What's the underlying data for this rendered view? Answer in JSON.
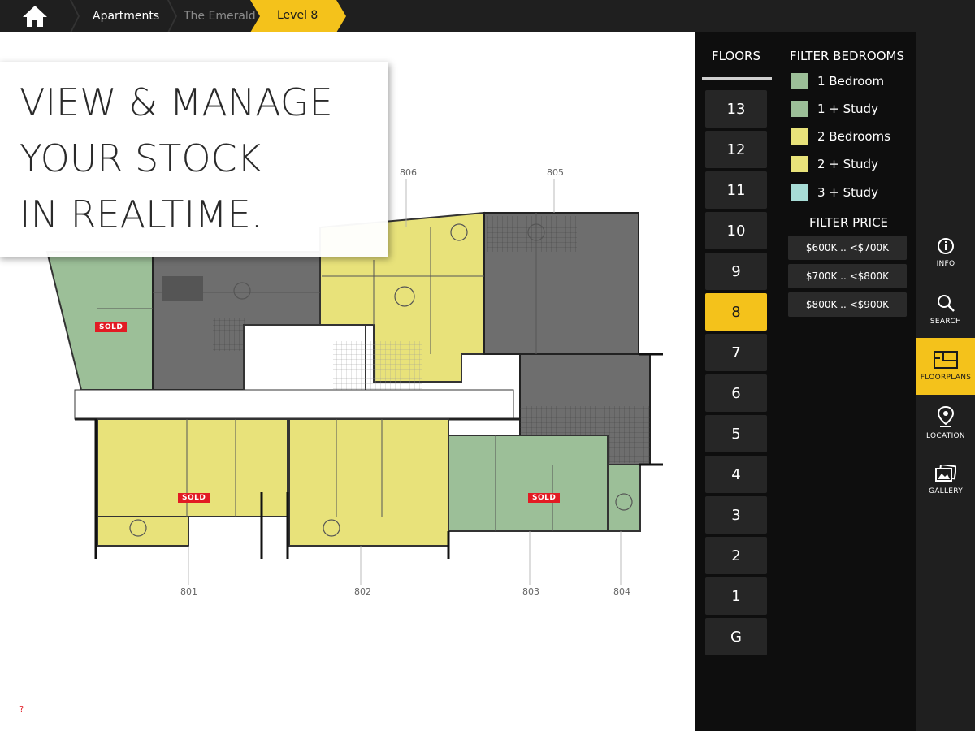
{
  "topbar": {
    "home_icon": "home-icon",
    "breadcrumbs": [
      "Apartments",
      "The Emerald",
      "Level 8"
    ]
  },
  "hero": {
    "lines": [
      "VIEW & MANAGE",
      "YOUR STOCK",
      "IN REALTIME."
    ]
  },
  "plan": {
    "unit_labels": [
      "806",
      "805",
      "801",
      "802",
      "803",
      "804"
    ],
    "sold_label": "SOLD",
    "footnote": "?"
  },
  "floors": {
    "title": "FLOORS",
    "items": [
      "13",
      "12",
      "11",
      "10",
      "9",
      "8",
      "7",
      "6",
      "5",
      "4",
      "3",
      "2",
      "1",
      "G"
    ],
    "active": "8"
  },
  "filters": {
    "bedrooms_title": "FILTER BEDROOMS",
    "bedrooms": [
      {
        "label": "1 Bedroom",
        "color": "#9cbf98"
      },
      {
        "label": "1 + Study",
        "color": "#9cbf98"
      },
      {
        "label": "2 Bedrooms",
        "color": "#e8e27a"
      },
      {
        "label": "2 + Study",
        "color": "#e8e27a"
      },
      {
        "label": "3 + Study",
        "color": "#a7dcd6"
      }
    ],
    "price_title": "FILTER PRICE",
    "prices": [
      "$600K .. <$700K",
      "$700K .. <$800K",
      "$800K .. <$900K"
    ]
  },
  "nav": {
    "items": [
      {
        "label": "INFO",
        "icon": "info-icon"
      },
      {
        "label": "SEARCH",
        "icon": "search-icon"
      },
      {
        "label": "FLOORPLANS",
        "icon": "floorplan-icon"
      },
      {
        "label": "LOCATION",
        "icon": "location-pin-icon"
      },
      {
        "label": "GALLERY",
        "icon": "gallery-icon"
      }
    ],
    "active": "FLOORPLANS"
  },
  "colors": {
    "accent": "#f4c21b",
    "green_unit": "#9cbf98",
    "yellow_unit": "#e8e27a",
    "grey_unit": "#6e6e6e",
    "sold": "#e21b23"
  }
}
